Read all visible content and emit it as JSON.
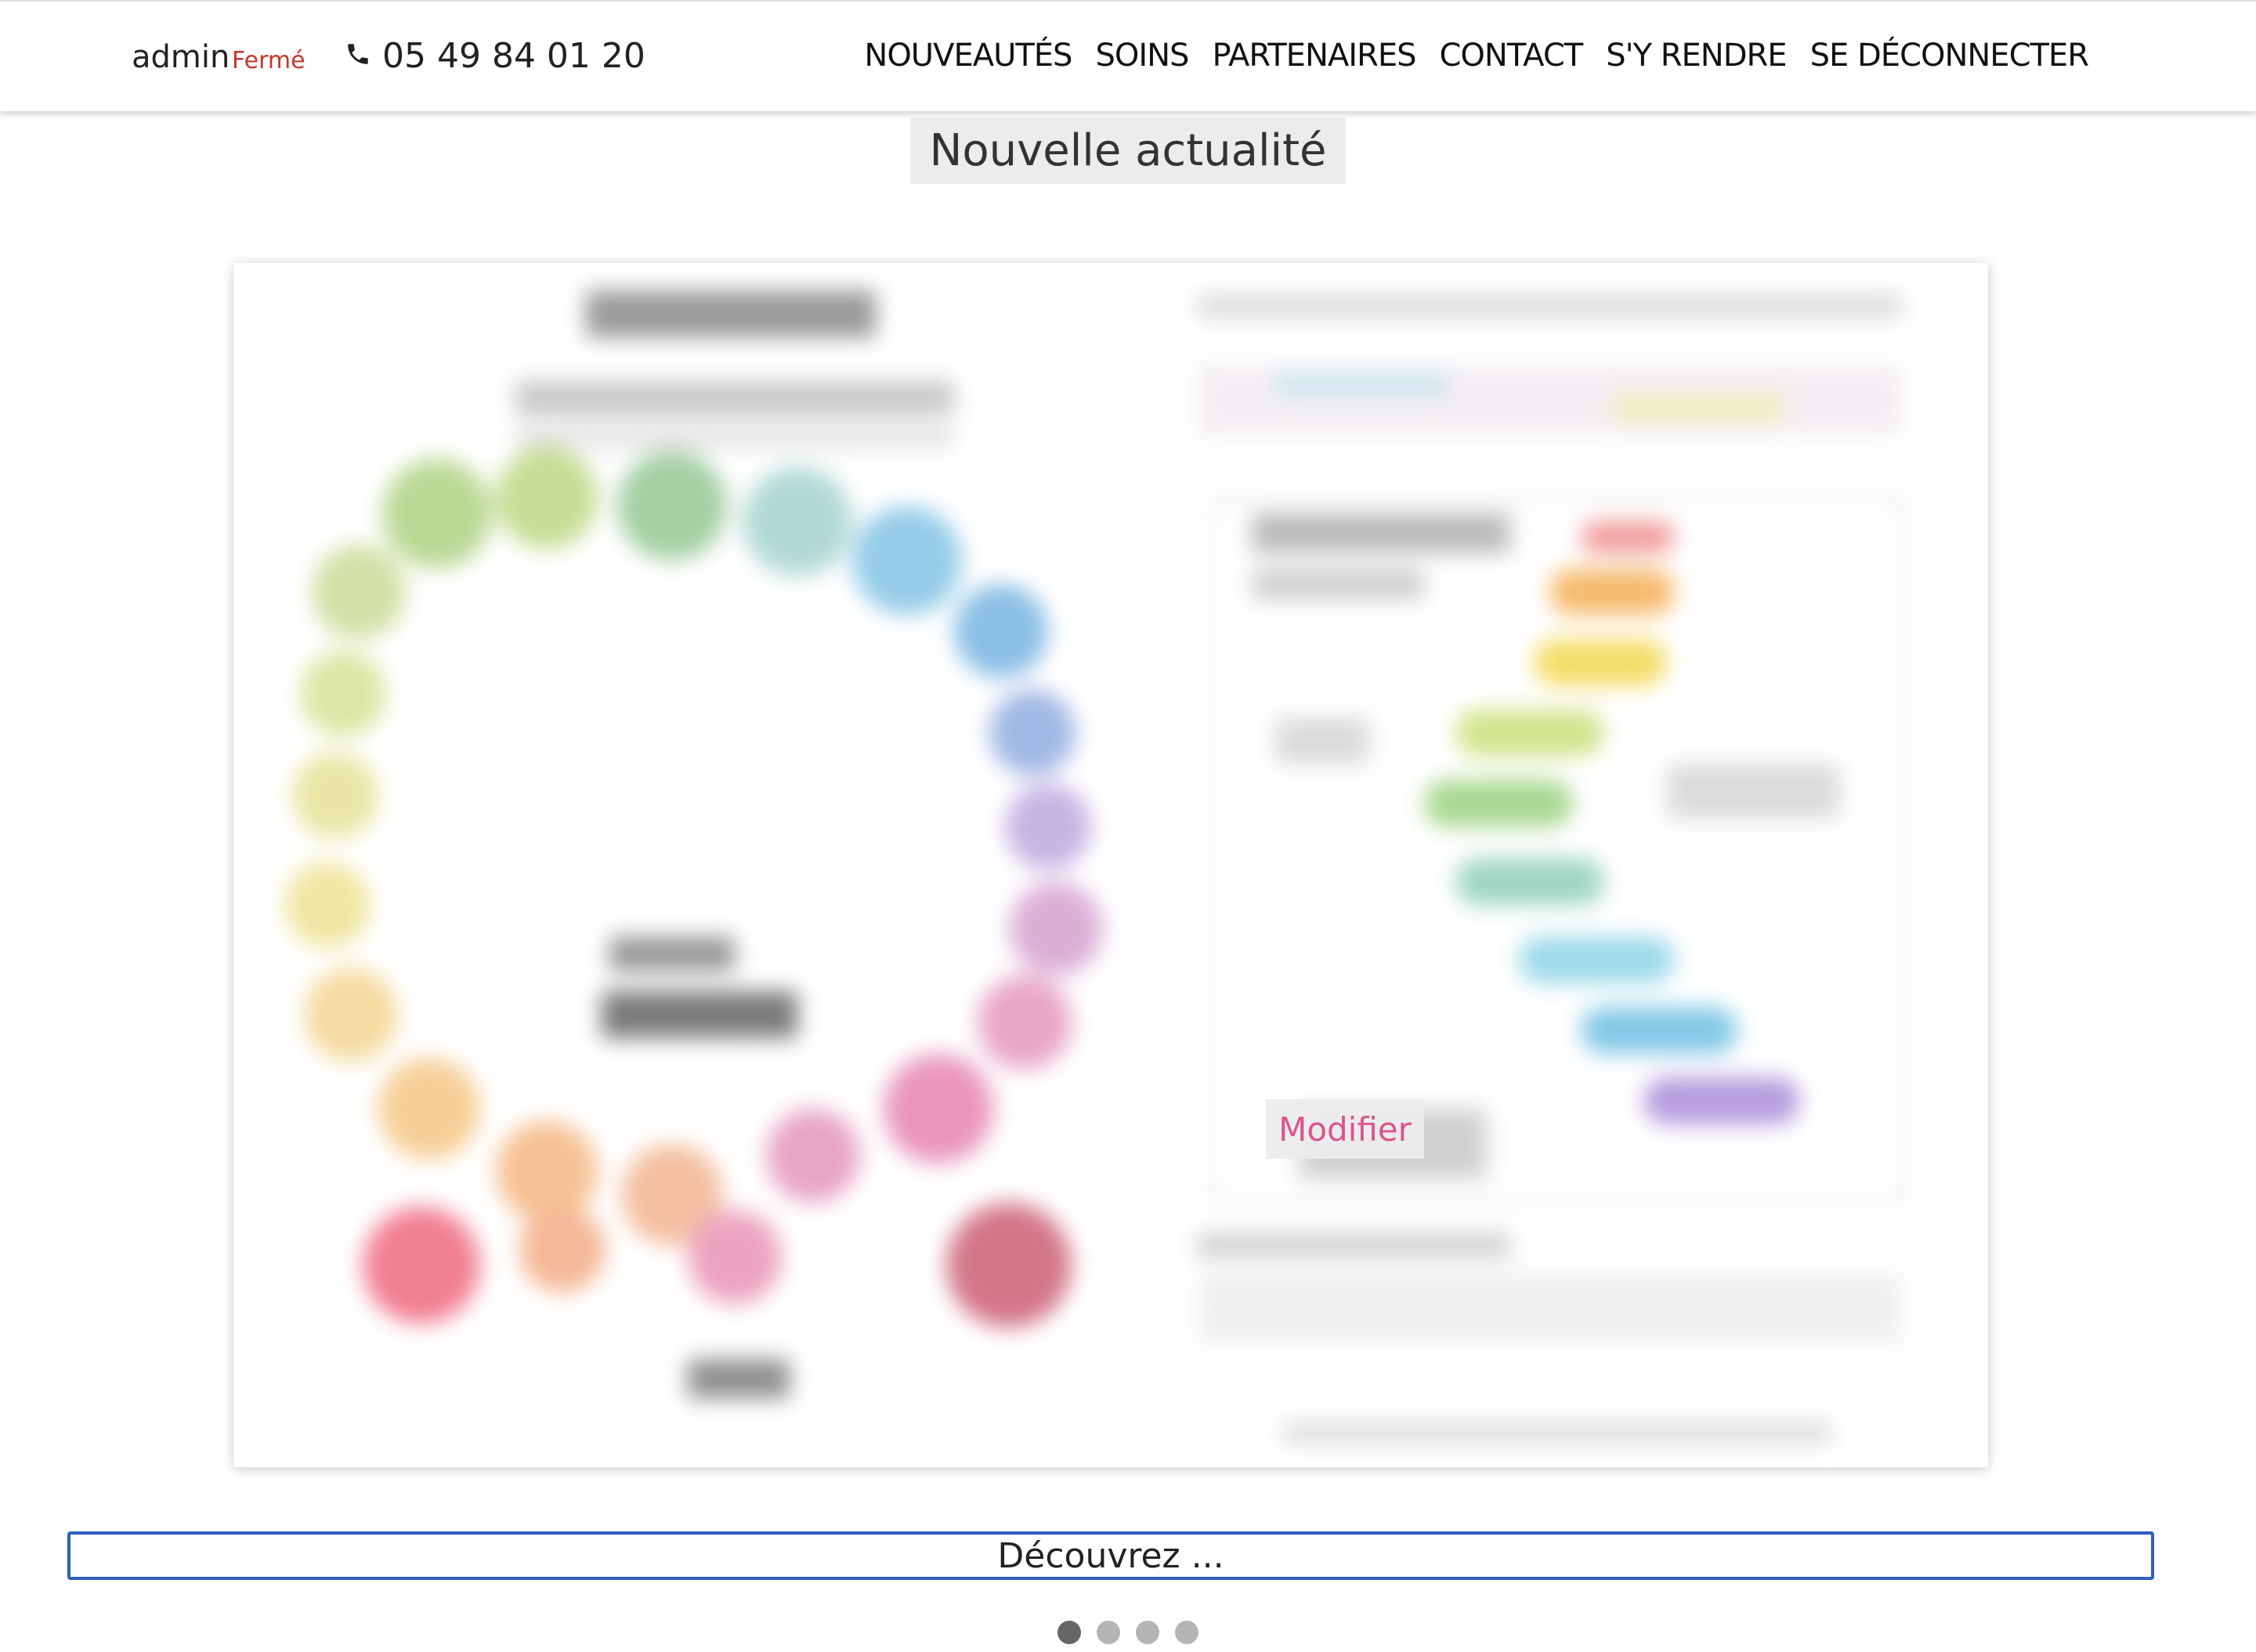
{
  "header": {
    "user": "admin",
    "status": "Fermé",
    "phone": "05 49 84 01 20",
    "nav": [
      "NOUVEAUTÉS",
      "SOINS",
      "PARTENAIRES",
      "CONTACT",
      "S'Y RENDRE",
      "SE DÉCONNECTER"
    ]
  },
  "main": {
    "title": "Nouvelle actualité",
    "image_modify_label": "Modifier",
    "caption_value": "Découvrez ...",
    "carousel": {
      "slide_count": 4,
      "active_index": 0
    }
  },
  "colors": {
    "status": "#c0392b",
    "modify": "#d9558b",
    "input_border": "#2d5fbf"
  }
}
